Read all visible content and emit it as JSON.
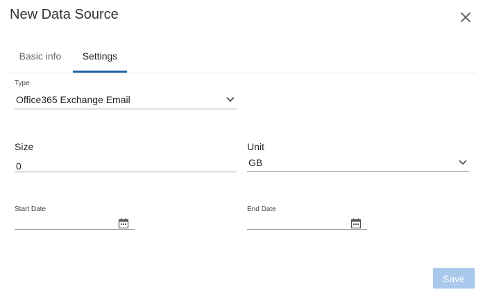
{
  "dialog": {
    "title": "New Data Source",
    "close_icon": "close-icon"
  },
  "tabs": [
    {
      "label": "Basic info",
      "active": false
    },
    {
      "label": "Settings",
      "active": true
    }
  ],
  "form": {
    "type": {
      "label": "Type",
      "value": "Office365 Exchange Email",
      "icon": "chevron-down-icon"
    },
    "size": {
      "label": "Size",
      "value": "0"
    },
    "unit": {
      "label": "Unit",
      "value": "GB",
      "icon": "chevron-down-icon"
    },
    "start_date": {
      "label": "Start Date",
      "value": "",
      "icon": "calendar-icon"
    },
    "end_date": {
      "label": "End Date",
      "value": "",
      "icon": "calendar-icon"
    }
  },
  "footer": {
    "save_label": "Save",
    "save_disabled": true
  },
  "colors": {
    "accent": "#1f5fa8",
    "save_disabled_bg": "#a9c9ec"
  }
}
